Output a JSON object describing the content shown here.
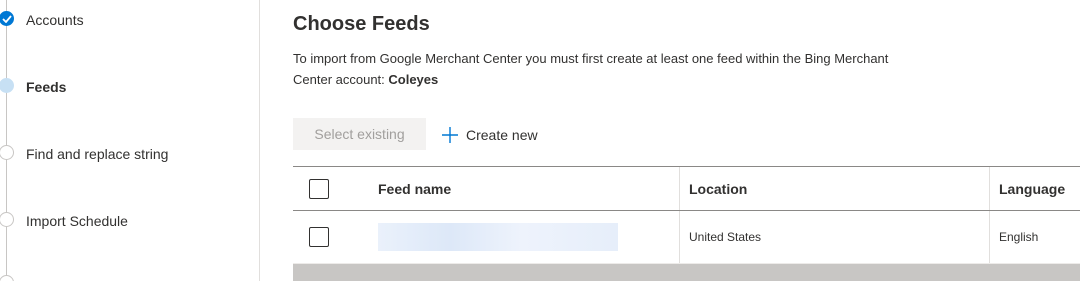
{
  "colors": {
    "accent": "#0078d4",
    "active_step": "#c7e0f4",
    "disabled_bg": "#f3f2f1",
    "disabled_text": "#a19f9d"
  },
  "steps": [
    {
      "label": "Accounts",
      "state": "completed",
      "icon": "checkmark-icon"
    },
    {
      "label": "Feeds",
      "state": "current"
    },
    {
      "label": "Find and replace string",
      "state": "pending"
    },
    {
      "label": "Import Schedule",
      "state": "pending"
    }
  ],
  "main": {
    "title": "Choose Feeds",
    "description_prefix": "To import from Google Merchant Center you must first create at least one feed within the Bing Merchant Center account: ",
    "account_name": "Coleyes",
    "select_existing_label": "Select existing",
    "create_new_label": "Create new",
    "create_new_icon": "plus-icon"
  },
  "table": {
    "columns": [
      "Feed name",
      "Location",
      "Language"
    ],
    "rows": [
      {
        "feed_name": "",
        "location": "United States",
        "language": "English"
      }
    ]
  }
}
